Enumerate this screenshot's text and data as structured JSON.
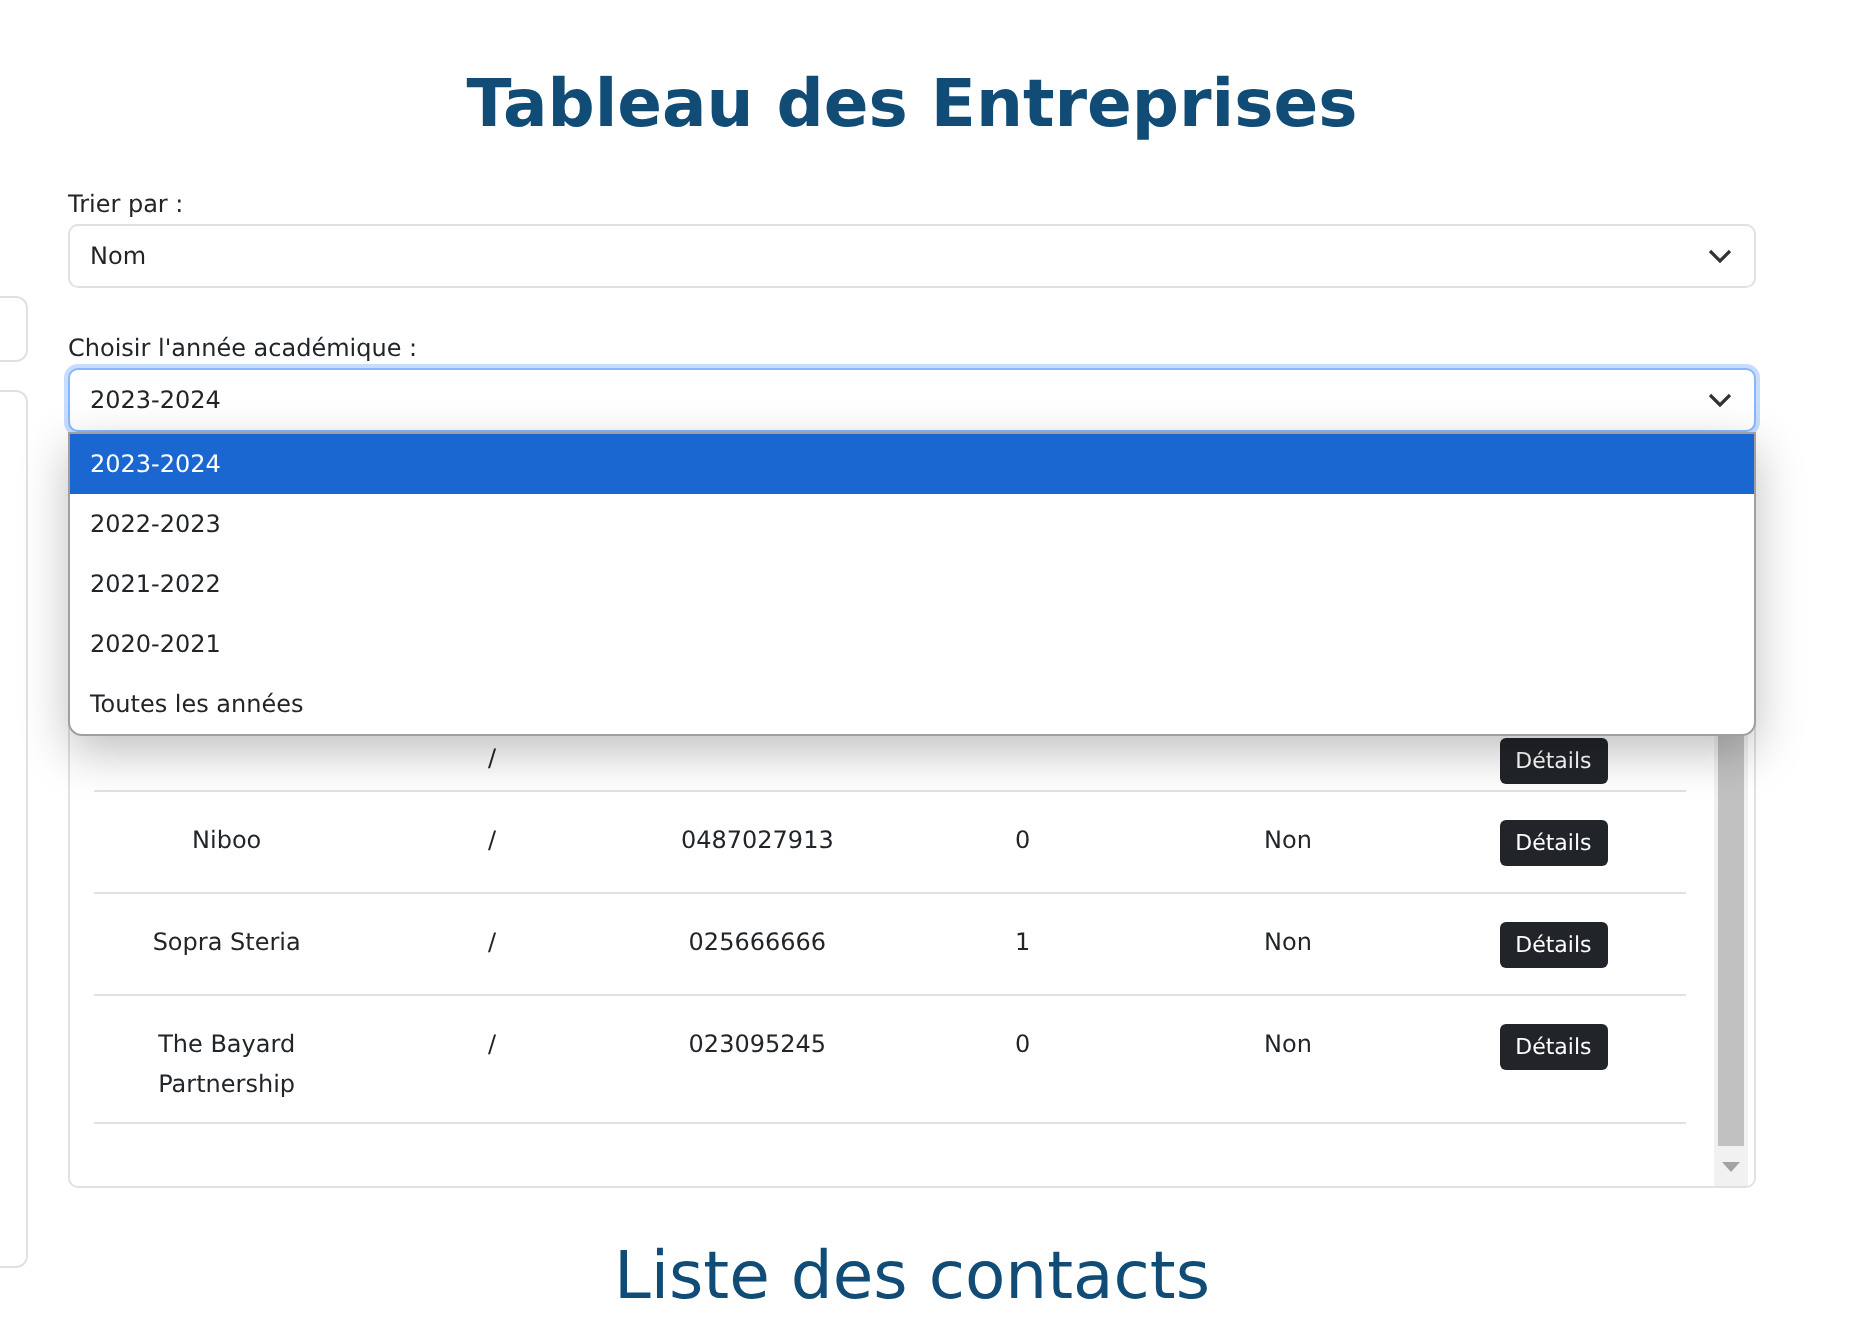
{
  "title": "Tableau des Entreprises",
  "sort": {
    "label": "Trier par :",
    "value": "Nom"
  },
  "year": {
    "label": "Choisir l'année académique :",
    "value": "2023-2024",
    "expanded": true,
    "options": [
      {
        "label": "2023-2024",
        "selected": true
      },
      {
        "label": "2022-2023",
        "selected": false
      },
      {
        "label": "2021-2022",
        "selected": false
      },
      {
        "label": "2020-2021",
        "selected": false
      },
      {
        "label": "Toutes les années",
        "selected": false
      }
    ]
  },
  "table": {
    "rows": [
      {
        "cells": [
          "",
          "/",
          "",
          "",
          "",
          ""
        ],
        "button": "Détails"
      },
      {
        "cells": [
          "Niboo",
          "/",
          "0487027913",
          "0",
          "Non"
        ],
        "button": "Détails"
      },
      {
        "cells": [
          "Sopra Steria",
          "/",
          "025666666",
          "1",
          "Non"
        ],
        "button": "Détails"
      },
      {
        "cells": [
          "The Bayard Partnership",
          "/",
          "023095245",
          "0",
          "Non"
        ],
        "button": "Détails"
      }
    ]
  },
  "next_title": "Liste des contacts"
}
